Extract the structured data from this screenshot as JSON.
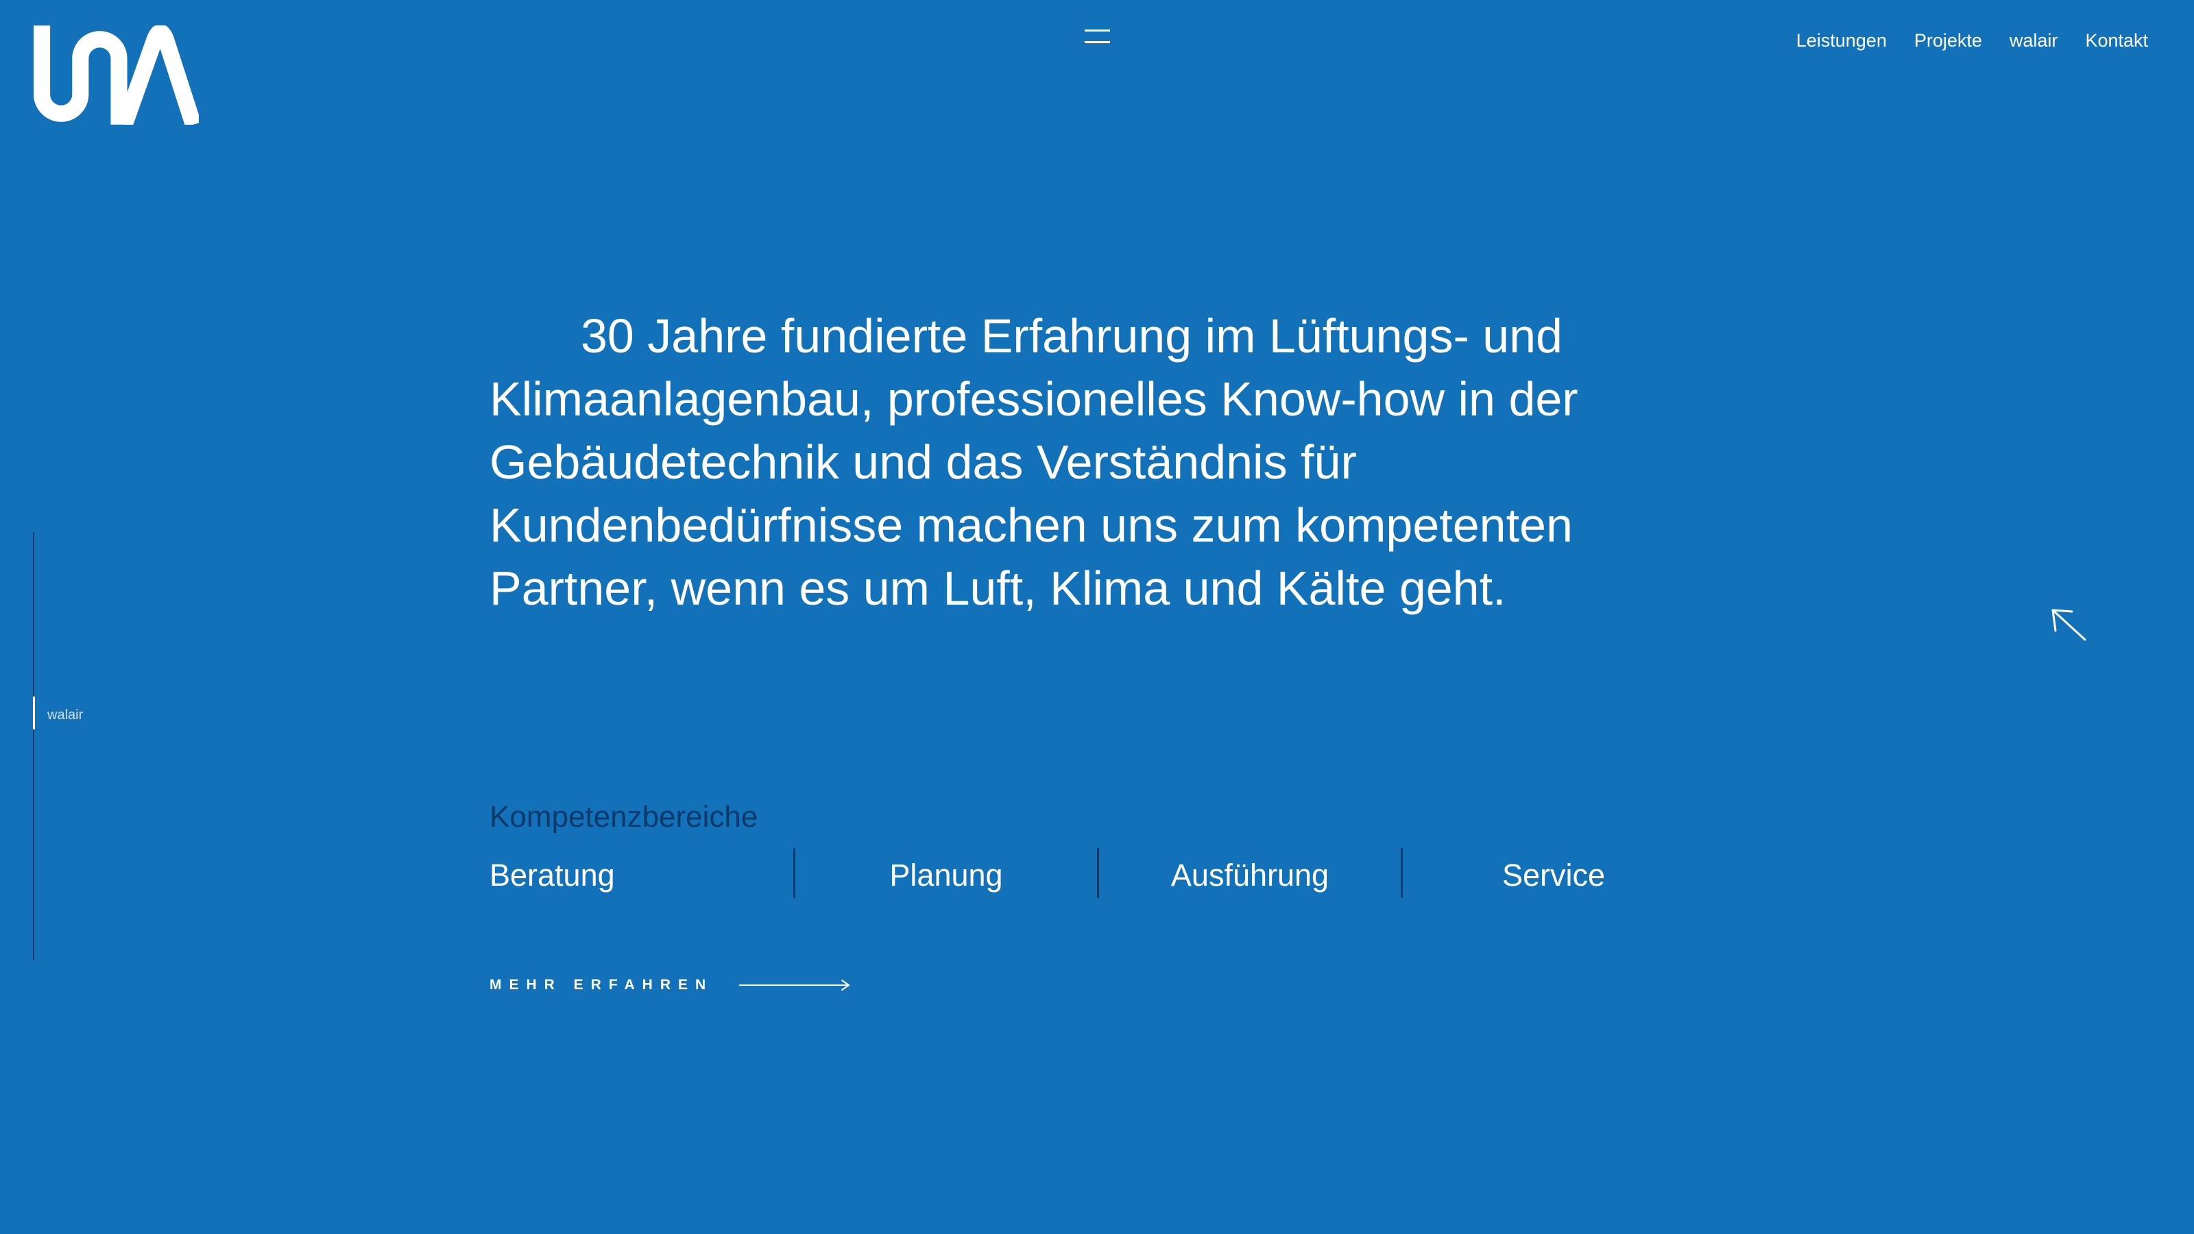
{
  "colors": {
    "background": "#1271b9",
    "text": "#ffffff",
    "accent_dark": "#0d3a6b",
    "side_label": "#cfe2f3"
  },
  "header": {
    "logo_icon": "walair-logo-icon",
    "menu_icon": "hamburger-menu-icon",
    "nav": [
      {
        "label": "Leistungen"
      },
      {
        "label": "Projekte"
      },
      {
        "label": "walair"
      },
      {
        "label": "Kontakt"
      }
    ]
  },
  "side_indicator": {
    "label": "walair"
  },
  "hero": {
    "lines": [
      "30 Jahre fundierte Erfahrung im Lüftungs- und",
      "Klimaanlagenbau, professionelles Know-how in der",
      "Gebäudetechnik und das Verständnis für",
      "Kundenbedürfnisse machen uns zum kompetenten",
      "Partner, wenn es um Luft, Klima und Kälte geht."
    ]
  },
  "competences": {
    "title": "Kompetenzbereiche",
    "items": [
      {
        "label": "Beratung"
      },
      {
        "label": "Planung"
      },
      {
        "label": "Ausführung"
      },
      {
        "label": "Service"
      }
    ]
  },
  "cta": {
    "label": "MEHR ERFAHREN",
    "icon": "arrow-right-icon"
  },
  "cursor": {
    "icon": "cursor-arrow-icon"
  }
}
